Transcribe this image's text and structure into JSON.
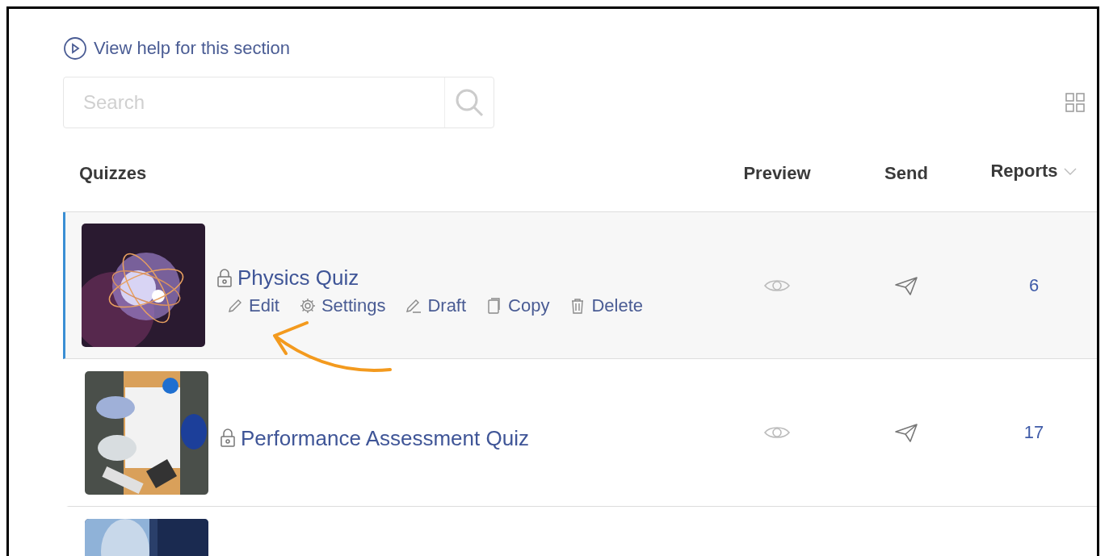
{
  "help_link": "View help for this section",
  "search": {
    "placeholder": "Search"
  },
  "table": {
    "columns": [
      "Quizzes",
      "Preview",
      "Send",
      "Reports"
    ],
    "rows": [
      {
        "selected": true,
        "title": "Physics Quiz",
        "locked": true,
        "reports": "6",
        "actions": [
          {
            "kind": "edit",
            "label": "Edit"
          },
          {
            "kind": "settings",
            "label": "Settings"
          },
          {
            "kind": "draft",
            "label": "Draft"
          },
          {
            "kind": "copy",
            "label": "Copy"
          },
          {
            "kind": "delete",
            "label": "Delete"
          }
        ]
      },
      {
        "selected": false,
        "title": "Performance Assessment Quiz",
        "locked": true,
        "reports": "17"
      },
      {
        "selected": false
      }
    ]
  }
}
